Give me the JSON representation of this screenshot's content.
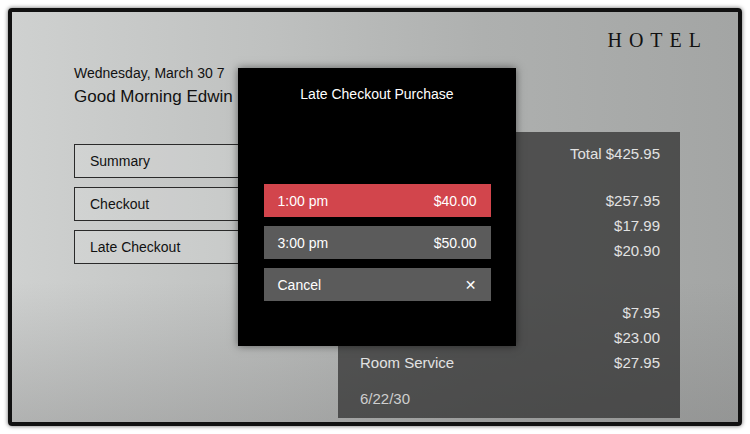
{
  "brand": "HOTEL",
  "date": "Wednesday, March 30 7",
  "greeting": "Good Morning Edwin",
  "menu": [
    {
      "label": "Summary"
    },
    {
      "label": "Checkout"
    },
    {
      "label": "Late Checkout"
    }
  ],
  "bill": {
    "total": "Total $425.95",
    "groups": [
      {
        "items": [
          {
            "amount": "$257.95"
          },
          {
            "amount": "$17.99"
          },
          {
            "amount": "$20.90"
          }
        ]
      },
      {
        "items": [
          {
            "amount": "$7.95"
          },
          {
            "amount": "$23.00"
          },
          {
            "label": "Room Service",
            "amount": "$27.95"
          }
        ]
      }
    ],
    "date": "6/22/30"
  },
  "dialog": {
    "title": "Late Checkout Purchase",
    "options": [
      {
        "time": "1:00 pm",
        "price": "$40.00",
        "selected": true
      },
      {
        "time": "3:00 pm",
        "price": "$50.00",
        "selected": false
      }
    ],
    "cancel": {
      "label": "Cancel",
      "icon": "✕"
    }
  }
}
